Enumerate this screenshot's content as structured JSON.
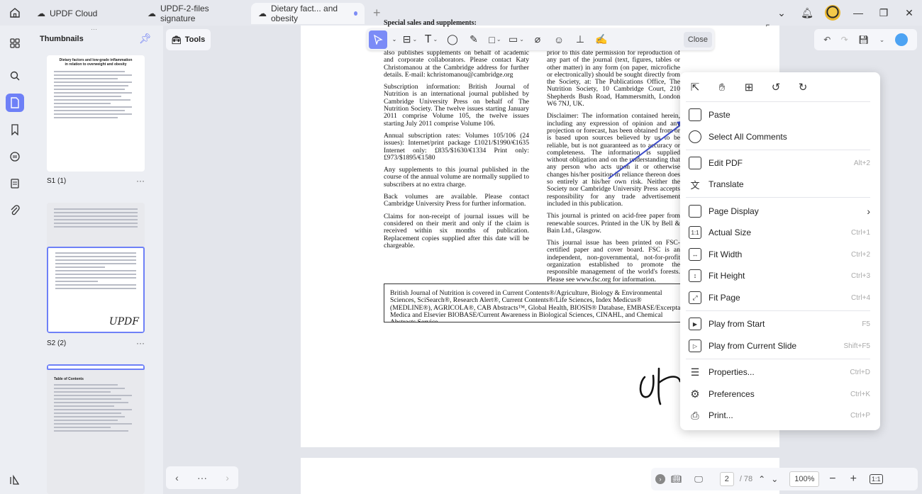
{
  "tabs": [
    {
      "label": "UPDF Cloud"
    },
    {
      "label": "UPDF-2-files signature"
    },
    {
      "label": "Dietary fact... and obesity"
    }
  ],
  "thumbnails": {
    "title": "Thumbnails",
    "items": [
      {
        "label": "S1 (1)",
        "title_line1": "Dietary factors and low-grade inflammation",
        "title_line2": "in relation to overweight and obesity"
      },
      {
        "label": "S2 (2)",
        "sig": "UPDF"
      },
      {
        "label": "",
        "header": "Table of Contents"
      }
    ]
  },
  "toolbar": {
    "tools_label": "Tools",
    "close_label": "Close"
  },
  "document": {
    "heading": "Special sales and supplements:",
    "left_col": [
      "also publishes supplements on behalf of academic and corporate collaborators. Please contact Katy Christomanou at the Cambridge address for further details. E-mail: kchristomanou@cambridge.org",
      "Subscription information: British Journal of Nutrition is an international journal published by Cambridge University Press on behalf of The Nutrition Society. The twelve issues starting January 2011 comprise Volume 105, the twelve issues starting July 2011 comprise Volume 106.",
      "Annual subscription rates: Volumes 105/106 (24 issues): Internet/print package £1021/$1990/€1635 Internet only: £835/$1630/€1334 Print only: £973/$1895/€1580",
      "Any supplements to this journal published in the course of the annual volume are normally supplied to subscribers at no extra charge.",
      "Back volumes are available. Please contact Cambridge University Press for further information.",
      "Claims for non-receipt of journal issues will be considered on their merit and only if the claim is received within six months of publication. Replacement copies supplied after this date will be chargeable."
    ],
    "right_col": [
      "prior to this date permission for reproduction of any part of the journal (text, figures, tables or other matter) in any form (on paper, microfiche or electronically) should be sought directly from the Society, at: The Publications Office, The Nutrition Society, 10 Cambridge Court, 210 Shepherds Bush Road, Hammersmith, London W6 7NJ, UK.",
      "Disclaimer: The information contained herein, including any expression of opinion and any projection or forecast, has been obtained from or is based upon sources believed by us to be reliable, but is not guaranteed as to accuracy or completeness. The information is supplied without obligation and on the understanding that any person who acts upon it or otherwise changes his/her position in reliance thereon does so entirely at his/her own risk. Neither the Society nor Cambridge University Press accepts responsibility for any trade advertisement included in this publication.",
      "This journal is printed on acid-free paper from renewable sources. Printed in the UK by Bell & Bain Ltd., Glasgow.",
      "This journal issue has been printed on FSC-certified paper and cover board. FSC is an independent, non-governmental, not-for-profit organization established to promote the responsible management of the world's forests. Please see www.fsc.org for information."
    ],
    "box_text": "British Journal of Nutrition is covered in Current Contents®/Agriculture, Biology & Environmental Sciences, SciSearch®, Research Alert®, Current Contents®/Life Sciences, Index Medicus® (MEDLINE®), AGRICOLA®, CAB Abstracts™, Global Health, BIOSIS® Database, EMBASE/Excerpta Medica and Elsevier BIOBASE/Current Awareness in Biological Sciences, CINAHL, and Chemical Abstracts Service."
  },
  "context_menu": {
    "items": [
      {
        "label": "Paste",
        "shortcut": ""
      },
      {
        "label": "Select All Comments",
        "shortcut": ""
      },
      {
        "label": "Edit PDF",
        "shortcut": "Alt+2"
      },
      {
        "label": "Translate",
        "shortcut": ""
      },
      {
        "label": "Page Display",
        "shortcut": "›"
      },
      {
        "label": "Actual Size",
        "shortcut": "Ctrl+1"
      },
      {
        "label": "Fit Width",
        "shortcut": "Ctrl+2"
      },
      {
        "label": "Fit Height",
        "shortcut": "Ctrl+3"
      },
      {
        "label": "Fit Page",
        "shortcut": "Ctrl+4"
      },
      {
        "label": "Play from Start",
        "shortcut": "F5"
      },
      {
        "label": "Play from Current Slide",
        "shortcut": "Shift+F5"
      },
      {
        "label": "Properties...",
        "shortcut": "Ctrl+D"
      },
      {
        "label": "Preferences",
        "shortcut": "Ctrl+K"
      },
      {
        "label": "Print...",
        "shortcut": "Ctrl+P"
      }
    ]
  },
  "bottom": {
    "page_current": "2",
    "page_total": "/ 78",
    "zoom": "100%",
    "more": "···"
  },
  "accent_color": "#7b8bf7"
}
